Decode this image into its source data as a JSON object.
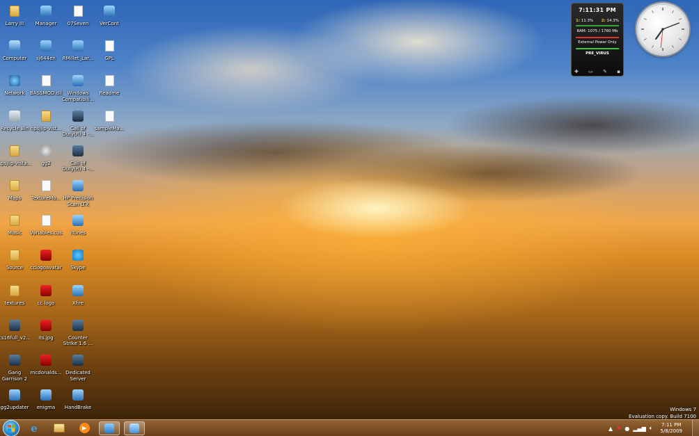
{
  "desktop": {
    "icons": [
      {
        "label": "Larry III",
        "icon": "folder-icon"
      },
      {
        "label": "Manager",
        "icon": "app-icon"
      },
      {
        "label": "07Seven",
        "icon": "doc-icon"
      },
      {
        "label": "VerCont",
        "icon": "app-icon"
      },
      {
        "label": "Computer",
        "icon": "computer-icon"
      },
      {
        "label": "sj644en",
        "icon": "app-icon"
      },
      {
        "label": "RMillet_Lar...",
        "icon": "app-icon"
      },
      {
        "label": "GPL",
        "icon": "doc-icon"
      },
      {
        "label": "Network",
        "icon": "network-icon"
      },
      {
        "label": "BASSMOD.dll",
        "icon": "doc-icon"
      },
      {
        "label": "Windows Compatibili...",
        "icon": "app-icon"
      },
      {
        "label": "Readme",
        "icon": "doc-icon"
      },
      {
        "label": "Recycle Bin",
        "icon": "recycle-bin-icon"
      },
      {
        "label": "hpsjiip-vist...",
        "icon": "folder-icon"
      },
      {
        "label": "Call of Duty(R) 4 -...",
        "icon": "game-icon"
      },
      {
        "label": "sampleMa...",
        "icon": "doc-icon"
      },
      {
        "label": "hpsjiip-vista...",
        "icon": "folder-icon"
      },
      {
        "label": "gg2",
        "icon": "gear-icon"
      },
      {
        "label": "Call of Duty(R) 4 -...",
        "icon": "game-icon"
      },
      {
        "label": "Maps",
        "icon": "folder-icon"
      },
      {
        "label": "TextureMo...",
        "icon": "doc-icon"
      },
      {
        "label": "HP Precision Scan LTX",
        "icon": "app-icon"
      },
      {
        "label": "Music",
        "icon": "folder-icon"
      },
      {
        "label": "Variables.cus",
        "icon": "doc-icon"
      },
      {
        "label": "iTunes",
        "icon": "app-icon"
      },
      {
        "label": "Source",
        "icon": "folder-icon"
      },
      {
        "label": "cclogoavatar",
        "icon": "image-icon"
      },
      {
        "label": "Skype",
        "icon": "skype-icon"
      },
      {
        "label": "textures",
        "icon": "folder-icon"
      },
      {
        "label": "cc logo",
        "icon": "image-icon"
      },
      {
        "label": "Xfire",
        "icon": "app-icon"
      },
      {
        "label": "cs16full_v2...",
        "icon": "game-icon"
      },
      {
        "label": "its.jpg",
        "icon": "image-icon"
      },
      {
        "label": "Counter Strike 1.6 ...",
        "icon": "game-icon"
      },
      {
        "label": "Gang Garrison 2",
        "icon": "game-icon"
      },
      {
        "label": "mcdonalds...",
        "icon": "image-icon"
      },
      {
        "label": "Dedicated Server",
        "icon": "game-icon"
      },
      {
        "label": "gg2updater",
        "icon": "app-icon"
      },
      {
        "label": "enigma",
        "icon": "app-icon"
      },
      {
        "label": "HandBrake",
        "icon": "app-icon"
      }
    ]
  },
  "gadget_meter": {
    "time": "7:11:31 PM",
    "cpu1_label": "1:",
    "cpu1": "11.3%",
    "cpu2_label": "2:",
    "cpu2": "14.3%",
    "ram": "RAM: 1075 / 1760 Mb",
    "power": "External Power Only",
    "network": "PRE_VIRUS"
  },
  "clock": {
    "hour": 7,
    "minute": 11,
    "second": 31
  },
  "watermark": {
    "line1": "Windows 7",
    "line2": "Evaluation copy. Build 7100"
  },
  "taskbar": {
    "pinned": [
      "start-orb",
      "internet-explorer-icon",
      "explorer-folder-icon",
      "media-player-icon",
      "app-icon",
      "app-icon"
    ],
    "tray_time": "7:11 PM",
    "tray_date": "5/8/2009"
  },
  "colors": {
    "taskbar": "#8a5526",
    "sky": "#3f73bf",
    "sunset": "#e89a3a"
  }
}
